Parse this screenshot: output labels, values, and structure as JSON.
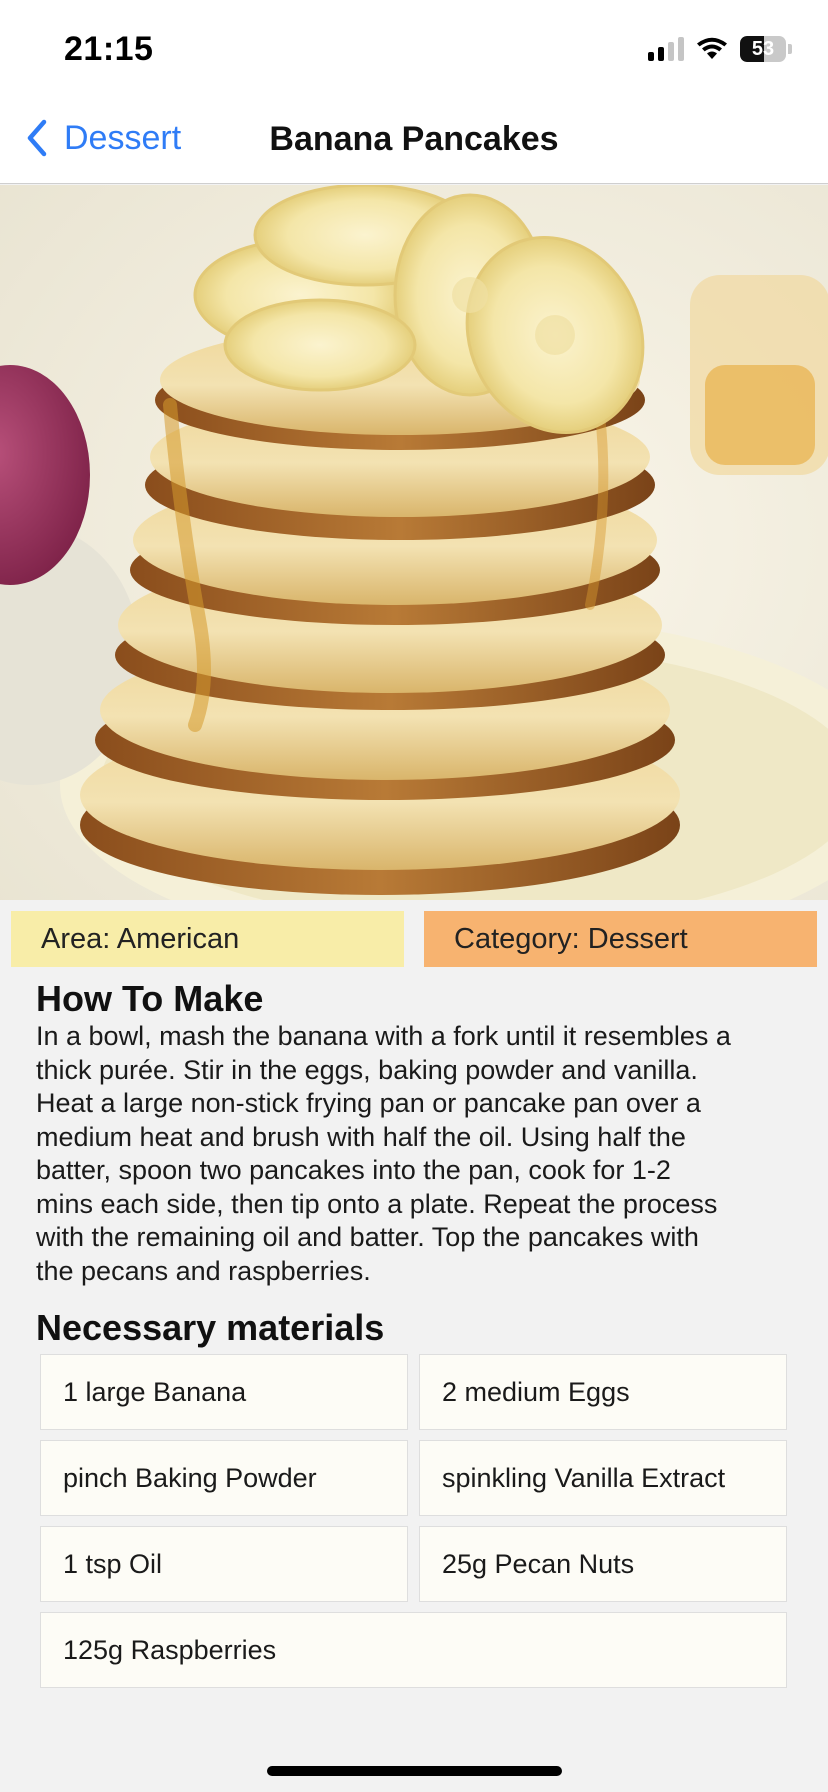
{
  "status_bar": {
    "time": "21:15",
    "battery_level": "53",
    "battery_percent": 53,
    "signal_bars_active": 2,
    "signal_bars_total": 4,
    "icons": [
      "cellular-signal-icon",
      "wifi-icon",
      "battery-icon"
    ]
  },
  "nav": {
    "back_label": "Dessert",
    "back_icon": "chevron-left-icon",
    "title": "Banana Pancakes",
    "accent_color": "#2f7cf6"
  },
  "hero": {
    "image_subject": "stack of banana pancakes with banana slices and syrup"
  },
  "tags": {
    "area": "Area: American",
    "area_color": "#f8eda8",
    "category": "Category: Dessert",
    "category_color": "#f7b370"
  },
  "how_to_make": {
    "title": "How To Make",
    "lines": [
      "In a bowl, mash the banana with a fork until it resembles a",
      "thick purée. Stir in the eggs, baking powder and vanilla.",
      "Heat a large non-stick frying pan or pancake pan over a",
      "medium heat and brush with half the oil. Using half the",
      "batter, spoon two pancakes into the pan, cook for 1-2",
      "mins each side, then tip onto a plate. Repeat the process",
      "with the remaining oil and batter. Top the pancakes with",
      "the pecans and raspberries."
    ]
  },
  "materials": {
    "title": "Necessary materials",
    "items": [
      "1 large Banana",
      "2 medium Eggs",
      "pinch Baking Powder",
      "spinkling Vanilla Extract",
      "1 tsp Oil",
      "25g Pecan Nuts",
      "125g Raspberries"
    ]
  }
}
